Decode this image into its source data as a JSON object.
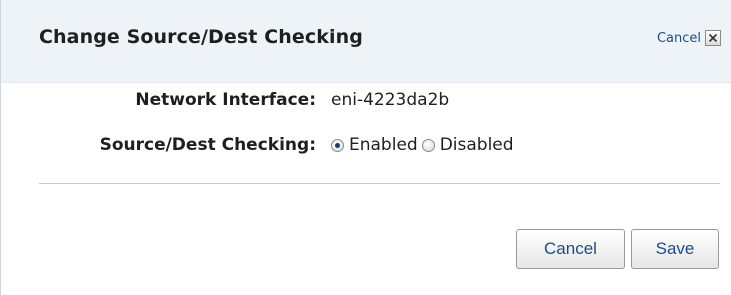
{
  "dialog": {
    "title": "Change Source/Dest Checking",
    "header_cancel_label": "Cancel"
  },
  "fields": {
    "network_interface": {
      "label": "Network Interface:",
      "value": "eni-4223da2b"
    },
    "source_dest_checking": {
      "label": "Source/Dest Checking:",
      "options": [
        "Enabled",
        "Disabled"
      ],
      "selected": "Enabled"
    }
  },
  "buttons": {
    "cancel_label": "Cancel",
    "save_label": "Save"
  },
  "icons": {
    "close": "close-icon"
  },
  "colors": {
    "header_bg": "#eef3f8",
    "link_text": "#1a4d8c",
    "divider": "#c8c8c8"
  }
}
